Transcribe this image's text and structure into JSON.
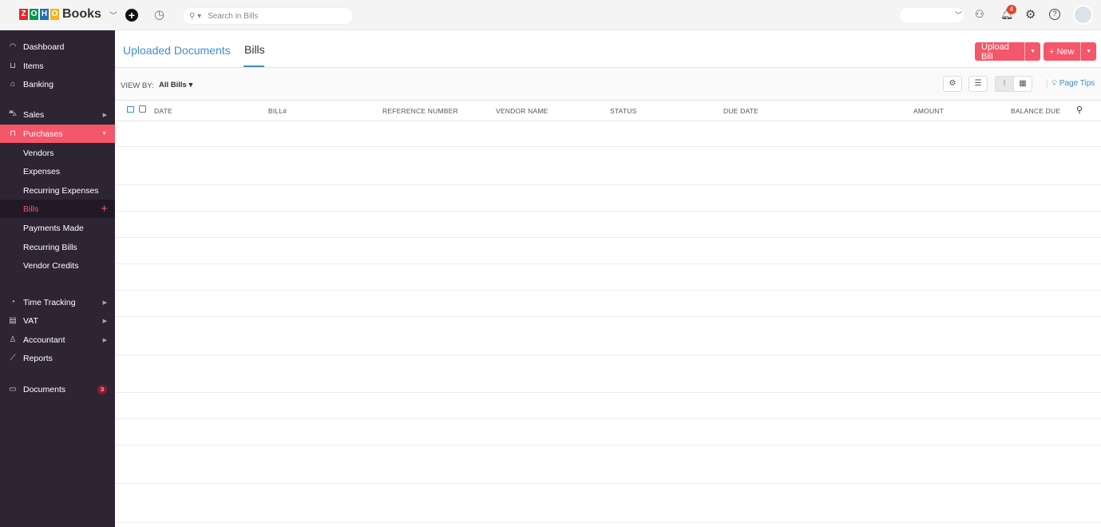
{
  "topbar": {
    "logo_letters": [
      "Z",
      "O",
      "H",
      "O"
    ],
    "logo_colors": [
      "#e42527",
      "#089949",
      "#226db4",
      "#f9b21d"
    ],
    "product": "Books",
    "search_placeholder": "Search in Bills",
    "notification_count": "4"
  },
  "sidebar": {
    "items": [
      {
        "label": "Dashboard",
        "icon": "dashboard-icon"
      },
      {
        "label": "Items",
        "icon": "basket-icon"
      },
      {
        "label": "Banking",
        "icon": "bank-icon"
      },
      {
        "label": "Sales",
        "icon": "cart-icon"
      },
      {
        "label": "Purchases",
        "icon": "bag-icon"
      },
      {
        "label": "Vendors"
      },
      {
        "label": "Expenses"
      },
      {
        "label": "Recurring Expenses"
      },
      {
        "label": "Bills"
      },
      {
        "label": "Payments Made"
      },
      {
        "label": "Recurring Bills"
      },
      {
        "label": "Vendor Credits"
      },
      {
        "label": "Time Tracking",
        "icon": "stopwatch-icon"
      },
      {
        "label": "VAT",
        "icon": "document-icon"
      },
      {
        "label": "Accountant",
        "icon": "accountant-icon"
      },
      {
        "label": "Reports",
        "icon": "chart-icon"
      },
      {
        "label": "Documents",
        "icon": "folder-icon",
        "badge": "3"
      }
    ]
  },
  "tabs": [
    {
      "label": "Uploaded Documents"
    },
    {
      "label": "Bills"
    }
  ],
  "buttons": {
    "upload": "Upload Bill",
    "new": "+ New",
    "page_tips": "Page Tips"
  },
  "view_by": {
    "label": "VIEW BY:",
    "value": "All Bills"
  },
  "columns": [
    "DATE",
    "BILL#",
    "REFERENCE NUMBER",
    "VENDOR NAME",
    "STATUS",
    "DUE DATE",
    "AMOUNT",
    "BALANCE DUE"
  ],
  "colors": {
    "accent": "#f4566a",
    "sidebar": "#2d2533",
    "link": "#408dc8"
  }
}
